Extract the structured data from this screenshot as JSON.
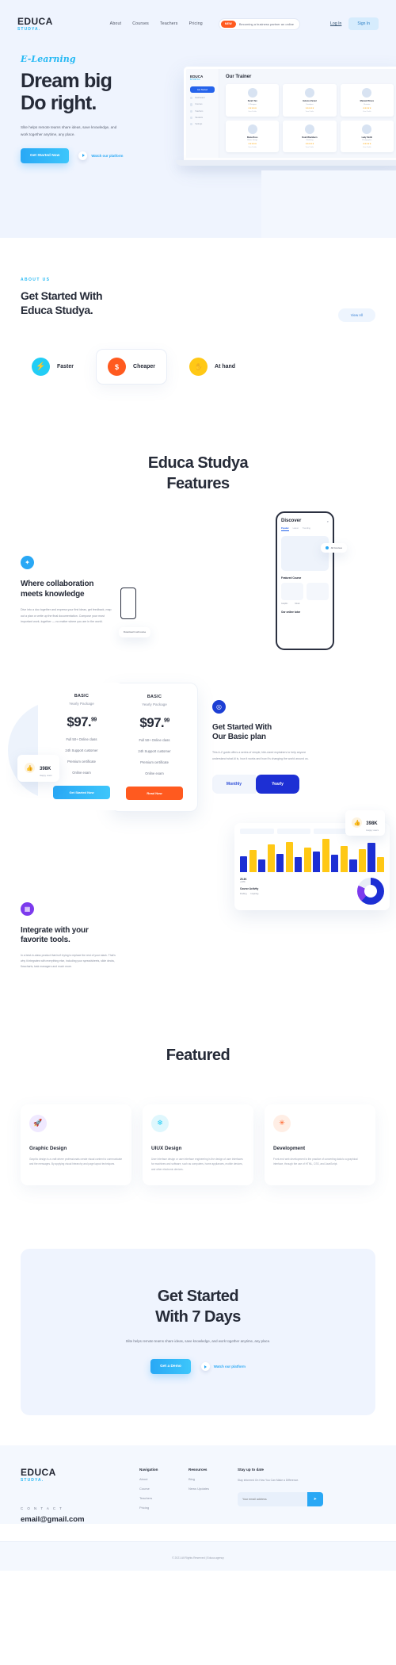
{
  "brand": {
    "name": "EDUCA",
    "sub": "STUDYA."
  },
  "nav": {
    "links": [
      "About",
      "Courses",
      "Teachers",
      "Pricing"
    ],
    "badge_tag": "NEW",
    "badge_text": "Becoming a business partner an online",
    "login": "Log In",
    "signin": "Sign In"
  },
  "hero": {
    "eyebrow": "E-Learning",
    "title_line1": "Dream big",
    "title_line2": "Do right.",
    "paragraph": "Slite helps remote teams share ideas, save knowledge, and work together anytime, any place.",
    "cta_primary": "Get Started Now",
    "cta_secondary": "Watch our platform",
    "laptop": {
      "brand": "EDUCA",
      "brand_sub": "STUDYA.",
      "cta": "Get Started",
      "menu": [
        "Dashboard",
        "Courses",
        "Teachers",
        "Students",
        "Settings"
      ],
      "panel_title": "Our Trainer",
      "trainers": [
        {
          "name": "Sarah Tan",
          "role": "UI Designer",
          "stars": "★★★★★",
          "more": "View Profile"
        },
        {
          "name": "Helena Ahmad",
          "role": "Developer",
          "stars": "★★★★★",
          "more": "View Profile"
        },
        {
          "name": "Maxwell Bruce",
          "role": "Illustrator",
          "stars": "★★★★★",
          "more": "View Profile"
        },
        {
          "name": "Diana Ross",
          "role": "Motion Design",
          "stars": "★★★★★",
          "more": "View Profile"
        },
        {
          "name": "Noah Blackburn",
          "role": "Marketing",
          "stars": "★★★★★",
          "more": "View Profile"
        },
        {
          "name": "Lady Smith",
          "role": "Photographer",
          "stars": "★★★★★",
          "more": "View Profile"
        }
      ]
    }
  },
  "about": {
    "kicker": "ABOUT US",
    "title_line1": "Get Started With",
    "title_line2": "Educa Studya.",
    "view_all": "View All",
    "pills": [
      {
        "label": "Faster",
        "icon": "lightning-icon",
        "glyph": "⚡",
        "color": "#22cdf5",
        "boxed": false
      },
      {
        "label": "Cheaper",
        "icon": "dollar-icon",
        "glyph": "$",
        "color": "#ff5a1f",
        "boxed": true
      },
      {
        "label": "At hand",
        "icon": "hand-icon",
        "glyph": "✋",
        "color": "#ffc815",
        "boxed": false
      }
    ]
  },
  "features_heading": {
    "line1": "Educa Studya",
    "line2": "Features"
  },
  "collab": {
    "icon": "globe-icon",
    "glyph": "✦",
    "title_line1": "Where collaboration",
    "title_line2": "meets knowledge",
    "paragraph": "Dive into a doc together and express your first ideas, get feedback, map out a plan or write up the final documentation. Compose your most important work, together — no matter where you are in the world.",
    "phone": {
      "title": "Discover",
      "search_icon": "search-icon",
      "tabs": [
        "Popular",
        "Latest",
        "Trending"
      ],
      "section1": "Featured Course",
      "section2": "Our online tutor",
      "chip1": "Graphic",
      "chip2": "Music",
      "float1": "All Courses",
      "float2": "Download in all course"
    }
  },
  "pricing": {
    "card": {
      "name": "BASIC",
      "package": "Yearly Package",
      "price": "$97.",
      "cents": "99",
      "features": [
        "Full 50+ Online class",
        "24h Support customer",
        "Premium certificate",
        "Online exam"
      ],
      "cta": "Get Started Now"
    },
    "card_alt": {
      "name": "BASIC",
      "package": "Yearly Package",
      "price": "$97.",
      "cents": "99",
      "features": [
        "Full 50+ Online class",
        "24h Support customer",
        "Premium certificate",
        "Online exam"
      ],
      "cta": "Read Now"
    },
    "happy": {
      "count": "398K",
      "label": "Happy users",
      "icon": "thumbs-up-icon",
      "glyph": "👍"
    },
    "right": {
      "icon": "target-icon",
      "glyph": "◎",
      "title_line1": "Get Started With",
      "title_line2": "Our Basic plan",
      "paragraph": "This A-Z guide offers a series of simple, bite-sized explainers to help anyone understand what Al is, how it works and how it's changing the world around us.",
      "toggle_off": "Monthly",
      "toggle_on": "Yearly"
    }
  },
  "integrate": {
    "icon": "grid-icon",
    "glyph": "▦",
    "title_line1": "Integrate with your",
    "title_line2": "favorite tools.",
    "paragraph": "In a best-in-class product that isn't trying to replace the rest of your stack. That's why it integrates with everything else, including your spreadsheets, slide decks, flowcharts, task managers and much more.",
    "badge": {
      "count": "398K",
      "label": "Happy users",
      "icon": "thumbs-up-icon",
      "glyph": "👍"
    },
    "dashboard": {
      "bar_values": [
        38,
        52,
        30,
        66,
        44,
        72,
        35,
        58,
        48,
        80,
        41,
        63,
        29,
        55,
        70,
        36
      ],
      "stat_value": "25.3K",
      "stat_delta": "+23%",
      "chart_label": "Course Activity",
      "legend": [
        "Finding",
        "Inspiring"
      ]
    }
  },
  "featured": {
    "heading": "Featured",
    "cards": [
      {
        "title": "Graphic Design",
        "icon": "rocket-icon",
        "glyph": "🚀",
        "bg": "#f0e9ff",
        "fg": "#7c3aed",
        "body": "Graphic design is a craft where professionals create visual content to communicate and the messages. By applying visual hierarchy and page layout techniques."
      },
      {
        "title": "UIUX Design",
        "icon": "layers-icon",
        "glyph": "❄",
        "bg": "#dff7fd",
        "fg": "#22cdf5",
        "body": "User interface design or user interface engineering is the design of user interfaces for machines and software, such as computers, home appliances, mobile devices, and other electronic devices."
      },
      {
        "title": "Development",
        "icon": "code-icon",
        "glyph": "✳",
        "bg": "#ffeee5",
        "fg": "#ff5a1f",
        "body": "Front-end web development is the practice of converting data to a graphical interface, through the use of HTML, CSS, and JavaScript."
      }
    ]
  },
  "cta": {
    "title_line1": "Get Started",
    "title_line2": "With 7 Days",
    "paragraph": "Slite helps remote teams share ideas, save knowledge, and work together anytime, any place.",
    "primary": "Get a Demo",
    "secondary": "Watch our platform"
  },
  "footer": {
    "contact_label": "C O N T A C T",
    "email": "email@gmail.com",
    "columns": [
      {
        "heading": "Navigation",
        "items": [
          "About",
          "Course",
          "Teachers",
          "Pricing"
        ]
      },
      {
        "heading": "Resources",
        "items": [
          "Blog",
          "News Updates"
        ]
      }
    ],
    "stay_heading": "Stay up to date",
    "stay_note": "Stay informed On How You Can Make a Difference.",
    "email_placeholder": "Your email address",
    "send_icon": "send-icon",
    "copyright": "© 2021 All Rights Reserved  |  Educa.agency"
  }
}
